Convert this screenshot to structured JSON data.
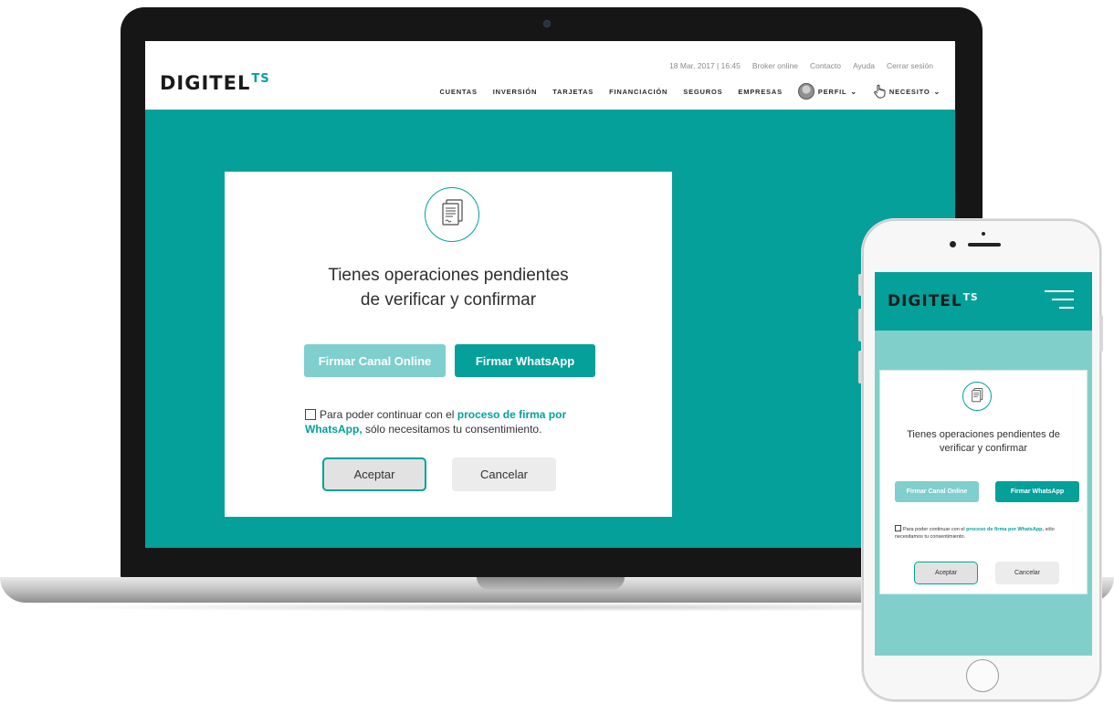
{
  "brand": {
    "name": "DIGITEL",
    "suffix": "TS"
  },
  "header": {
    "utility_links": [
      "18 Mar, 2017 | 16:45",
      "Broker online",
      "Contacto",
      "Ayuda",
      "Cerrar sesión"
    ],
    "nav": [
      "CUENTAS",
      "INVERSIÓN",
      "TARJETAS",
      "FINANCIACIÓN",
      "SEGUROS",
      "EMPRESAS"
    ],
    "profile_label": "PERFIL",
    "need_label": "NECESITO"
  },
  "modal": {
    "title_line1": "Tienes operaciones pendientes",
    "title_line2": "de verificar y confirmar",
    "phone_title_line1": "Tienes operaciones pendientes de",
    "phone_title_line2": "verificar y confirmar",
    "btn_online": "Firmar Canal Online",
    "btn_whatsapp": "Firmar WhatsApp",
    "consent_before": "Para poder continuar con el ",
    "consent_link": "proceso de firma por WhatsApp,",
    "consent_after": " sólo necesitamos tu consentimiento.",
    "accept": "Aceptar",
    "cancel": "Cancelar"
  },
  "icons": {
    "document": "document-icon",
    "hamburger": "hamburger-menu-icon",
    "hand": "hand-pointer-icon",
    "avatar": "avatar-icon",
    "chevron": "chevron-down-icon"
  },
  "colors": {
    "accent": "#05a09a",
    "accent_light": "#7ecfcd",
    "phone_background": "#80cfca"
  }
}
